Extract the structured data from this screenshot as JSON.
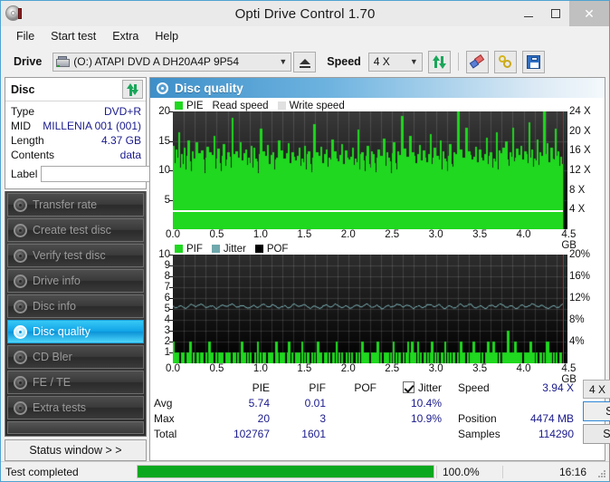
{
  "window": {
    "title": "Opti Drive Control 1.70",
    "app_icon": "disc-icon",
    "minimize": "—",
    "maximize": "☐",
    "close": "✕"
  },
  "menu": {
    "items": [
      {
        "label": "File"
      },
      {
        "label": "Start test"
      },
      {
        "label": "Extra"
      },
      {
        "label": "Help"
      }
    ]
  },
  "toolbar": {
    "drive_label": "Drive",
    "drive_value": "(O:)  ATAPI DVD A  DH20A4P 9P54",
    "drive_icon": "drive-icon",
    "eject_icon": "eject-icon",
    "speed_label": "Speed",
    "speed_value": "4 X",
    "refresh_icon": "refresh-arrows-icon",
    "erase_icon": "eraser-icon",
    "tools_icon": "tools-icon",
    "save_icon": "save-floppy-icon"
  },
  "disc_panel": {
    "title": "Disc",
    "refresh_icon": "refresh-arrows-icon",
    "rows": [
      {
        "key": "Type",
        "value": "DVD+R"
      },
      {
        "key": "MID",
        "value": "MILLENIA 001 (001)"
      },
      {
        "key": "Length",
        "value": "4.37 GB"
      },
      {
        "key": "Contents",
        "value": "data"
      }
    ],
    "label_key": "Label",
    "label_value": "",
    "label_placeholder": "",
    "cd_icon": "cd-disc-icon"
  },
  "sidebar": {
    "items": [
      {
        "label": "Transfer rate",
        "icon": "disc-icon",
        "active": false
      },
      {
        "label": "Create test disc",
        "icon": "disc-icon",
        "active": false
      },
      {
        "label": "Verify test disc",
        "icon": "disc-icon",
        "active": false
      },
      {
        "label": "Drive info",
        "icon": "disc-icon",
        "active": false
      },
      {
        "label": "Disc info",
        "icon": "disc-icon",
        "active": false
      },
      {
        "label": "Disc quality",
        "icon": "disc-icon",
        "active": true
      },
      {
        "label": "CD Bler",
        "icon": "disc-icon",
        "active": false
      },
      {
        "label": "FE / TE",
        "icon": "disc-icon",
        "active": false
      },
      {
        "label": "Extra tests",
        "icon": "disc-icon",
        "active": false
      }
    ],
    "status_window_button": "Status window > >"
  },
  "panel": {
    "header_title": "Disc quality",
    "header_icon": "disc-quality-icon"
  },
  "chart_data": [
    {
      "type": "bar",
      "name": "pie-chart",
      "title": "",
      "legend": [
        {
          "label": "PIE",
          "color": "#1fd81f"
        },
        {
          "label": "Read speed",
          "color": "#ffffff"
        },
        {
          "label": "Write speed",
          "color": "#e0e0e0"
        }
      ],
      "legend_position": "top-left",
      "xlabel": "GB",
      "ylabel": "",
      "xlim": [
        0.0,
        4.5
      ],
      "ylim": [
        0,
        20
      ],
      "y2lim": [
        0,
        24
      ],
      "y2label": "X",
      "xticks": [
        "0.0",
        "0.5",
        "1.0",
        "1.5",
        "2.0",
        "2.5",
        "3.0",
        "3.5",
        "4.0",
        "4.5 GB"
      ],
      "yticks": [
        "5",
        "10",
        "15",
        "20"
      ],
      "y2ticks": [
        "4 X",
        "8 X",
        "12 X",
        "16 X",
        "20 X",
        "24 X"
      ],
      "grid": true,
      "read_speed_line_value": 3.94,
      "end_marker_gb": 4.45,
      "values": [
        14.2,
        11.3,
        13.6,
        12.1,
        16.4,
        10.4,
        12.8,
        11.0,
        13.9,
        10.2,
        12.4,
        15.1,
        11.6,
        9.8,
        13.2,
        12.0,
        10.6,
        14.7,
        11.1,
        12.9,
        10.1,
        13.4,
        11.8,
        9.6,
        12.2,
        14.0,
        10.8,
        13.1,
        11.4,
        12.6,
        15.8,
        10.3,
        12.0,
        13.7,
        11.2,
        9.9,
        12.5,
        14.4,
        10.7,
        11.9,
        13.0,
        12.3,
        10.5,
        18.9,
        12.7,
        11.5,
        13.3,
        10.0,
        12.1,
        14.8,
        11.7,
        9.7,
        12.9,
        13.5,
        10.9,
        12.2,
        11.3,
        14.1,
        10.4,
        13.8,
        12.0,
        11.6,
        9.5,
        12.8,
        17.0,
        11.1,
        13.2,
        10.6,
        12.4,
        14.3,
        11.0,
        9.8,
        12.6,
        13.0,
        10.2,
        11.8,
        12.1,
        15.0,
        10.7,
        13.4,
        11.5,
        12.0,
        9.9,
        12.9,
        14.6,
        11.2,
        10.4,
        13.1,
        12.3,
        11.7,
        9.6,
        12.5,
        13.9,
        10.8,
        12.0,
        11.4,
        14.2,
        10.1,
        12.7,
        13.3,
        11.0,
        9.7,
        12.2,
        17.8,
        11.6,
        13.0,
        10.5,
        12.4,
        14.0,
        11.3,
        9.9,
        12.8,
        13.6,
        10.6,
        12.1,
        11.8,
        15.2,
        10.3,
        13.2,
        12.0,
        11.5,
        9.8,
        12.6,
        14.5,
        11.1,
        10.7,
        13.4,
        12.2,
        11.9,
        9.6,
        12.3,
        13.8,
        10.9,
        12.0,
        11.4,
        16.9,
        10.2,
        12.7,
        13.1,
        11.7,
        9.9,
        12.5,
        14.1,
        11.0,
        10.4,
        13.3,
        12.8,
        11.2,
        9.7,
        12.1,
        13.5,
        10.6,
        12.4,
        11.8,
        15.4,
        10.8,
        13.0,
        12.2,
        11.5,
        9.5,
        12.9,
        14.7,
        11.3,
        10.1,
        13.2,
        12.6,
        11.9,
        19.2,
        12.0,
        13.7,
        10.9,
        12.3,
        11.6,
        15.9,
        10.4,
        13.1,
        12.5,
        11.2,
        9.8,
        12.7,
        14.3,
        11.7,
        10.5,
        13.4,
        12.1,
        11.4,
        9.6,
        12.8,
        16.2,
        11.0,
        12.2,
        13.9,
        10.7,
        12.4,
        11.8,
        15.1,
        10.2,
        13.3,
        12.0,
        11.6,
        9.9,
        12.5,
        14.4,
        11.1,
        10.6,
        13.0,
        12.7,
        11.3,
        20.1,
        12.9,
        13.6,
        10.8,
        12.1,
        11.5,
        17.2,
        10.3,
        13.2,
        12.6,
        11.9,
        9.7,
        12.3,
        14.0,
        11.4,
        10.9,
        13.5,
        12.2,
        11.7,
        9.8,
        12.8,
        15.6,
        11.0,
        12.4,
        13.1,
        10.5,
        12.0,
        11.6,
        16.5,
        10.1,
        13.4,
        12.9,
        11.2,
        13.8,
        12.5,
        14.9,
        11.8,
        10.7,
        13.0,
        12.3,
        17.3,
        11.5,
        12.1,
        13.7,
        10.4,
        12.6,
        14.2,
        11.9,
        10.0,
        13.3,
        12.8,
        11.3,
        18.1,
        12.2,
        13.5,
        10.6,
        12.0,
        11.7,
        15.3,
        10.9,
        13.1,
        12.4,
        11.1,
        20.0,
        12.7,
        14.6,
        11.4,
        10.2,
        13.9,
        12.0,
        11.8,
        17.1,
        12.5,
        13.2,
        10.8,
        12.3,
        11.0
      ]
    },
    {
      "type": "bar",
      "name": "pif-chart",
      "title": "",
      "legend": [
        {
          "label": "PIF",
          "color": "#1fd81f"
        },
        {
          "label": "Jitter",
          "color": "#6fa8ad"
        },
        {
          "label": "POF",
          "color": "#000000"
        }
      ],
      "legend_position": "top-left",
      "xlabel": "GB",
      "ylabel": "",
      "xlim": [
        0.0,
        4.5
      ],
      "ylim": [
        0,
        10
      ],
      "y2lim": [
        0,
        20
      ],
      "y2label": "%",
      "xticks": [
        "0.0",
        "0.5",
        "1.0",
        "1.5",
        "2.0",
        "2.5",
        "3.0",
        "3.5",
        "4.0",
        "4.5 GB"
      ],
      "yticks": [
        "1",
        "2",
        "3",
        "4",
        "5",
        "6",
        "7",
        "8",
        "9",
        "10"
      ],
      "y2ticks": [
        "4%",
        "8%",
        "12%",
        "16%",
        "20%"
      ],
      "grid": true,
      "jitter_avg_percent": 10.4,
      "jitter_series_value": 5.25,
      "end_marker_gb": 4.45,
      "values": [
        2,
        1,
        0,
        1,
        0,
        0,
        1,
        1,
        0,
        0,
        1,
        0,
        2,
        0,
        1,
        0,
        0,
        1,
        0,
        1,
        1,
        0,
        0,
        1,
        0,
        2,
        0,
        1,
        0,
        0,
        1,
        0,
        1,
        0,
        1,
        0,
        0,
        1,
        0,
        1,
        0,
        0,
        1,
        1,
        0,
        1,
        0,
        0,
        2,
        0,
        1,
        0,
        1,
        0,
        1,
        0,
        0,
        1,
        0,
        2,
        0,
        1,
        0,
        1,
        1,
        0,
        0,
        1,
        0,
        1,
        0,
        0,
        2,
        1,
        0,
        1,
        0,
        1,
        0,
        0,
        1,
        2,
        0,
        1,
        0,
        0,
        1,
        0,
        1,
        0,
        2,
        0,
        1,
        0,
        1,
        0,
        0,
        1,
        0,
        1,
        0,
        2,
        0,
        1,
        0,
        0,
        1,
        1,
        0,
        1,
        0,
        0,
        1,
        0,
        2,
        0,
        1,
        0,
        1,
        0,
        0,
        1,
        0,
        1,
        0,
        1,
        0,
        0,
        1,
        0,
        1,
        0,
        2,
        0,
        1,
        0,
        1,
        0,
        0,
        1,
        0,
        1,
        0,
        2,
        0,
        1,
        0,
        0,
        1,
        0,
        1,
        0,
        1,
        0,
        2,
        0,
        1,
        0,
        1,
        0,
        0,
        1,
        0,
        1,
        2,
        0,
        1,
        2,
        0,
        1,
        0,
        2,
        0,
        1,
        0,
        0,
        1,
        0,
        1,
        0,
        1,
        2,
        0,
        1,
        0,
        1,
        0,
        0,
        1,
        0,
        2,
        0,
        1,
        0,
        1,
        0,
        1,
        0,
        0,
        1,
        0,
        2,
        0,
        1,
        0,
        0,
        1,
        0,
        1,
        0,
        2,
        0,
        1,
        0,
        1,
        0,
        1,
        0,
        0,
        1,
        2,
        0,
        1,
        0,
        2,
        0,
        1,
        0,
        1,
        0,
        0,
        1,
        0,
        1,
        3,
        0,
        1,
        0,
        1,
        2,
        0,
        1,
        0,
        1,
        0,
        0,
        1,
        0,
        1,
        0,
        2,
        0,
        1,
        0,
        1,
        0,
        0,
        1,
        0,
        1,
        0,
        2,
        2,
        0,
        1,
        0,
        1,
        0,
        1,
        0,
        0,
        1,
        0
      ]
    }
  ],
  "stats": {
    "columns": [
      "PIE",
      "PIF",
      "POF"
    ],
    "jitter_label": "Jitter",
    "jitter_checked": true,
    "rows": [
      {
        "label": "Avg",
        "pie": "5.74",
        "pif": "0.01",
        "pof": "",
        "jitter": "10.4%"
      },
      {
        "label": "Max",
        "pie": "20",
        "pif": "3",
        "pof": "",
        "jitter": "10.9%"
      },
      {
        "label": "Total",
        "pie": "102767",
        "pif": "1601",
        "pof": "",
        "jitter": ""
      }
    ],
    "right": [
      {
        "key": "Speed",
        "value": "3.94 X"
      },
      {
        "key": "Position",
        "value": "4474 MB"
      },
      {
        "key": "Samples",
        "value": "114290"
      }
    ],
    "speed_select": "4 X",
    "start_full": "Start full",
    "start_part": "Start part"
  },
  "statusbar": {
    "message": "Test completed",
    "progress_percent": 100.0,
    "progress_text": "100.0%",
    "time": "16:16"
  },
  "colors": {
    "accent": "#12a5e8",
    "green": "#1fd81f",
    "progress_green": "#0aa81f",
    "marker_red": "#ff0000",
    "value_blue": "#1a1a8c"
  }
}
